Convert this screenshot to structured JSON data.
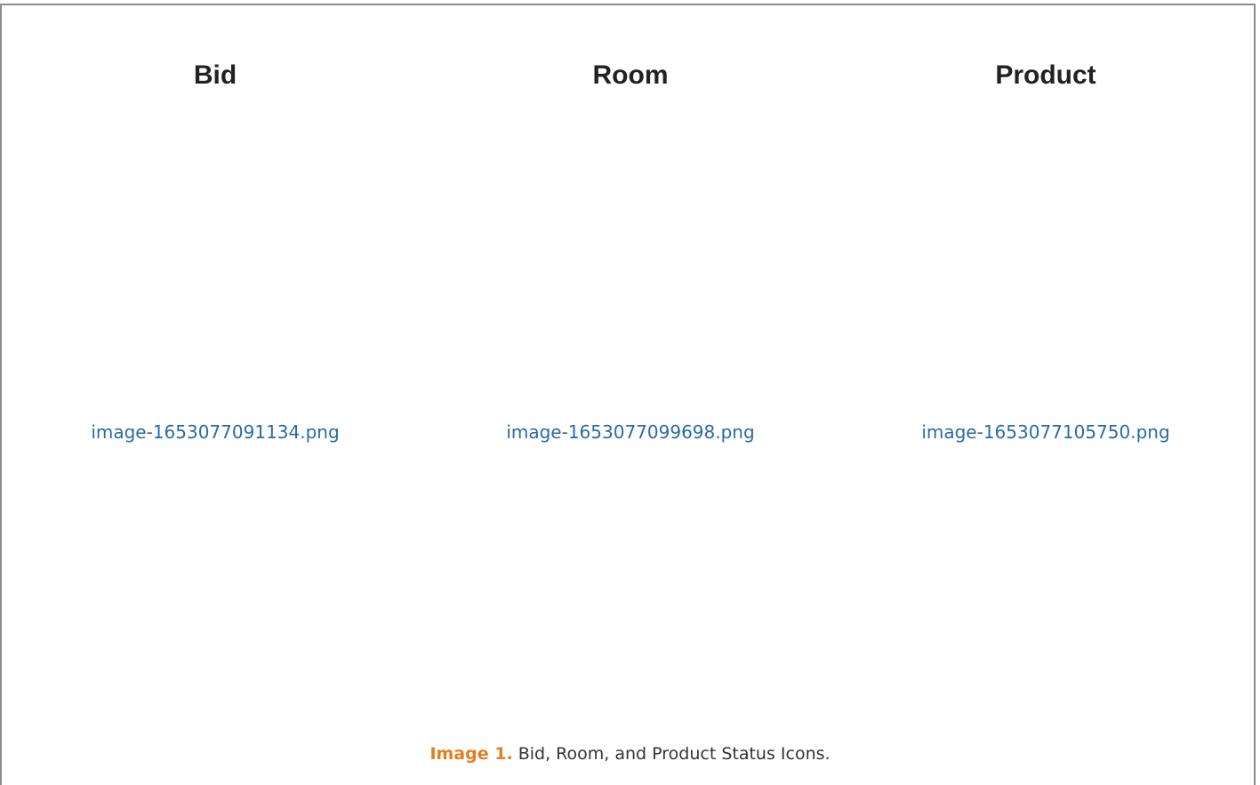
{
  "table": {
    "headers": [
      "Bid",
      "Room",
      "Product"
    ],
    "images": [
      "image-1653077091134.png",
      "image-1653077099698.png",
      "image-1653077105750.png"
    ]
  },
  "caption": {
    "label": "Image 1.",
    "text": " Bid, Room, and Product Status Icons."
  },
  "colors": {
    "link": "#2a6ba6",
    "caption_label": "#e27f1e",
    "heading": "#222222",
    "border": "#8c8c8c"
  }
}
